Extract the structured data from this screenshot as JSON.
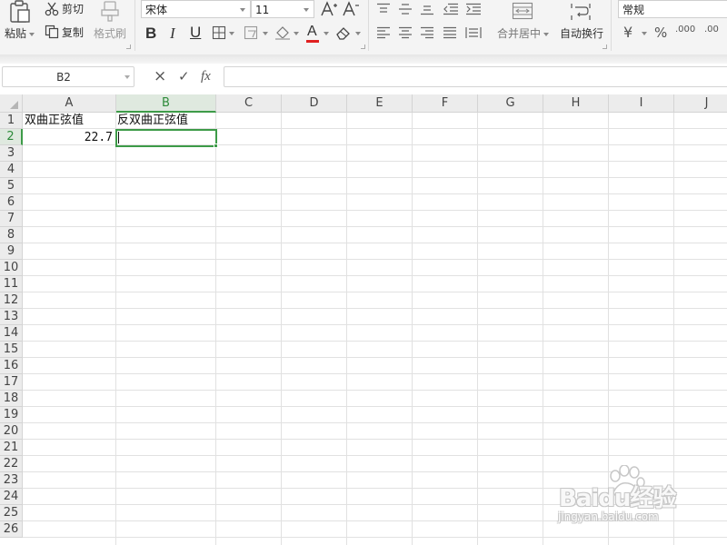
{
  "ribbon": {
    "clipboard": {
      "paste_label": "粘贴",
      "cut_label": "剪切",
      "copy_label": "复制",
      "format_painter_label": "格式刷"
    },
    "font": {
      "font_name": "宋体",
      "font_size": "11",
      "bold_glyph": "B",
      "italic_glyph": "I",
      "underline_glyph": "U",
      "font_color_glyph": "A",
      "font_color": "#e02020"
    },
    "alignment": {
      "merge_center_label": "合并居中",
      "wrap_text_label": "自动换行"
    },
    "number": {
      "format_value": "常规",
      "currency_glyph": "¥",
      "percent_glyph": "%",
      "decimal_increase_glyph": ".000",
      "decimal_decrease_glyph": ".00"
    }
  },
  "formula_bar": {
    "name_box": "B2",
    "cancel_glyph": "×",
    "enter_glyph": "✓",
    "function_glyph": "fx",
    "formula_value": ""
  },
  "grid": {
    "columns": [
      "A",
      "B",
      "C",
      "D",
      "E",
      "F",
      "G",
      "H",
      "I",
      "J"
    ],
    "active_column": "B",
    "rows": [
      "1",
      "2",
      "3",
      "4",
      "5",
      "6",
      "7",
      "8",
      "9",
      "10",
      "11",
      "12",
      "13",
      "14",
      "15",
      "16",
      "17",
      "18",
      "19",
      "20",
      "21",
      "22",
      "23",
      "24",
      "25",
      "26"
    ],
    "active_row": "2",
    "cells": {
      "A1": "双曲正弦值",
      "B1": "反双曲正弦值",
      "A2": "22.7",
      "B2": ""
    },
    "selection_color": "#3d9b48"
  },
  "watermark": {
    "main_text": "Baidu经验",
    "sub_text": "jingyan.baidu.com"
  }
}
